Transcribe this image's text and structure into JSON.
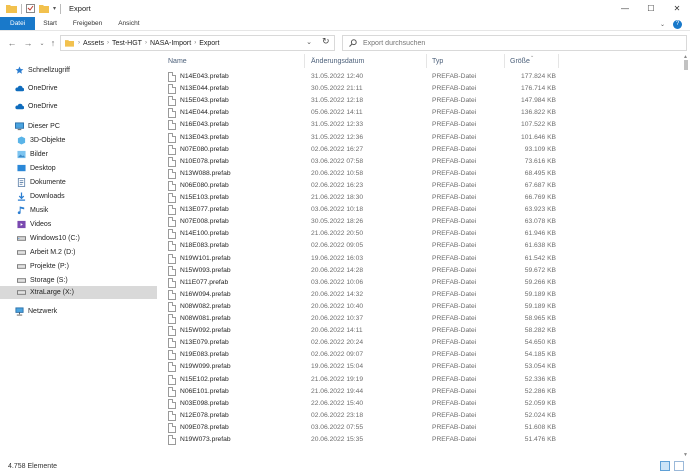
{
  "window": {
    "title": "Export"
  },
  "ribbon": {
    "tabs": [
      "Datei",
      "Start",
      "Freigeben",
      "Ansicht"
    ]
  },
  "address": {
    "crumbs": [
      "Assets",
      "Test-HGT",
      "NASA-Import",
      "Export"
    ]
  },
  "search": {
    "placeholder": "Export durchsuchen"
  },
  "nav": {
    "items": [
      {
        "label": "Schnellzugriff",
        "icon": "star-icon"
      },
      {
        "label": "OneDrive",
        "icon": "cloud-icon"
      },
      {
        "label": "OneDrive",
        "icon": "cloud-icon"
      },
      {
        "label": "Dieser PC",
        "icon": "pc-icon"
      },
      {
        "label": "3D-Objekte",
        "icon": "cube-icon"
      },
      {
        "label": "Bilder",
        "icon": "pictures-icon"
      },
      {
        "label": "Desktop",
        "icon": "desktop-icon"
      },
      {
        "label": "Dokumente",
        "icon": "documents-icon"
      },
      {
        "label": "Downloads",
        "icon": "downloads-icon"
      },
      {
        "label": "Musik",
        "icon": "music-icon"
      },
      {
        "label": "Videos",
        "icon": "videos-icon"
      },
      {
        "label": "Windows10 (C:)",
        "icon": "drive-icon"
      },
      {
        "label": "Arbeit M.2 (D:)",
        "icon": "drive-icon"
      },
      {
        "label": "Projekte (P:)",
        "icon": "drive-icon"
      },
      {
        "label": "Storage (S:)",
        "icon": "drive-icon"
      },
      {
        "label": "XtraLarge (X:)",
        "icon": "drive-icon"
      },
      {
        "label": "Netzwerk",
        "icon": "network-icon"
      }
    ],
    "selected_index": 15
  },
  "columns": {
    "name": "Name",
    "date": "Änderungsdatum",
    "type": "Typ",
    "size": "Größe"
  },
  "files": [
    {
      "name": "N14E043.prefab",
      "date": "31.05.2022 12:40",
      "type": "PREFAB-Datei",
      "size": "177.824 KB"
    },
    {
      "name": "N13E044.prefab",
      "date": "30.05.2022 21:11",
      "type": "PREFAB-Datei",
      "size": "176.714 KB"
    },
    {
      "name": "N15E043.prefab",
      "date": "31.05.2022 12:18",
      "type": "PREFAB-Datei",
      "size": "147.984 KB"
    },
    {
      "name": "N14E044.prefab",
      "date": "05.06.2022 14:11",
      "type": "PREFAB-Datei",
      "size": "136.822 KB"
    },
    {
      "name": "N16E043.prefab",
      "date": "31.05.2022 12:33",
      "type": "PREFAB-Datei",
      "size": "107.522 KB"
    },
    {
      "name": "N13E043.prefab",
      "date": "31.05.2022 12:36",
      "type": "PREFAB-Datei",
      "size": "101.646 KB"
    },
    {
      "name": "N07E080.prefab",
      "date": "02.06.2022 16:27",
      "type": "PREFAB-Datei",
      "size": "93.109 KB"
    },
    {
      "name": "N10E078.prefab",
      "date": "03.06.2022 07:58",
      "type": "PREFAB-Datei",
      "size": "73.616 KB"
    },
    {
      "name": "N13W088.prefab",
      "date": "20.06.2022 10:58",
      "type": "PREFAB-Datei",
      "size": "68.495 KB"
    },
    {
      "name": "N06E080.prefab",
      "date": "02.06.2022 16:23",
      "type": "PREFAB-Datei",
      "size": "67.687 KB"
    },
    {
      "name": "N15E103.prefab",
      "date": "21.06.2022 18:30",
      "type": "PREFAB-Datei",
      "size": "66.769 KB"
    },
    {
      "name": "N13E077.prefab",
      "date": "03.06.2022 10:18",
      "type": "PREFAB-Datei",
      "size": "63.923 KB"
    },
    {
      "name": "N07E008.prefab",
      "date": "30.05.2022 18:26",
      "type": "PREFAB-Datei",
      "size": "63.078 KB"
    },
    {
      "name": "N14E100.prefab",
      "date": "21.06.2022 20:50",
      "type": "PREFAB-Datei",
      "size": "61.946 KB"
    },
    {
      "name": "N18E083.prefab",
      "date": "02.06.2022 09:05",
      "type": "PREFAB-Datei",
      "size": "61.638 KB"
    },
    {
      "name": "N19W101.prefab",
      "date": "19.06.2022 16:03",
      "type": "PREFAB-Datei",
      "size": "61.542 KB"
    },
    {
      "name": "N15W093.prefab",
      "date": "20.06.2022 14:28",
      "type": "PREFAB-Datei",
      "size": "59.672 KB"
    },
    {
      "name": "N11E077.prefab",
      "date": "03.06.2022 10:06",
      "type": "PREFAB-Datei",
      "size": "59.266 KB"
    },
    {
      "name": "N16W094.prefab",
      "date": "20.06.2022 14:32",
      "type": "PREFAB-Datei",
      "size": "59.189 KB"
    },
    {
      "name": "N08W082.prefab",
      "date": "20.06.2022 10:40",
      "type": "PREFAB-Datei",
      "size": "59.189 KB"
    },
    {
      "name": "N08W081.prefab",
      "date": "20.06.2022 10:37",
      "type": "PREFAB-Datei",
      "size": "58.965 KB"
    },
    {
      "name": "N15W092.prefab",
      "date": "20.06.2022 14:11",
      "type": "PREFAB-Datei",
      "size": "58.282 KB"
    },
    {
      "name": "N13E079.prefab",
      "date": "02.06.2022 20:24",
      "type": "PREFAB-Datei",
      "size": "54.650 KB"
    },
    {
      "name": "N19E083.prefab",
      "date": "02.06.2022 09:07",
      "type": "PREFAB-Datei",
      "size": "54.185 KB"
    },
    {
      "name": "N19W099.prefab",
      "date": "19.06.2022 15:04",
      "type": "PREFAB-Datei",
      "size": "53.054 KB"
    },
    {
      "name": "N15E102.prefab",
      "date": "21.06.2022 19:19",
      "type": "PREFAB-Datei",
      "size": "52.336 KB"
    },
    {
      "name": "N06E101.prefab",
      "date": "21.06.2022 19:44",
      "type": "PREFAB-Datei",
      "size": "52.286 KB"
    },
    {
      "name": "N03E098.prefab",
      "date": "22.06.2022 15:40",
      "type": "PREFAB-Datei",
      "size": "52.059 KB"
    },
    {
      "name": "N12E078.prefab",
      "date": "02.06.2022 23:18",
      "type": "PREFAB-Datei",
      "size": "52.024 KB"
    },
    {
      "name": "N09E078.prefab",
      "date": "03.06.2022 07:55",
      "type": "PREFAB-Datei",
      "size": "51.608 KB"
    },
    {
      "name": "N19W073.prefab",
      "date": "20.06.2022 15:35",
      "type": "PREFAB-Datei",
      "size": "51.476 KB"
    }
  ],
  "status": {
    "count": "4.758 Elemente"
  },
  "colors": {
    "file_tab": "#1979ca",
    "selected_nav": "#d9d9d9",
    "header_text": "#4c607a"
  }
}
